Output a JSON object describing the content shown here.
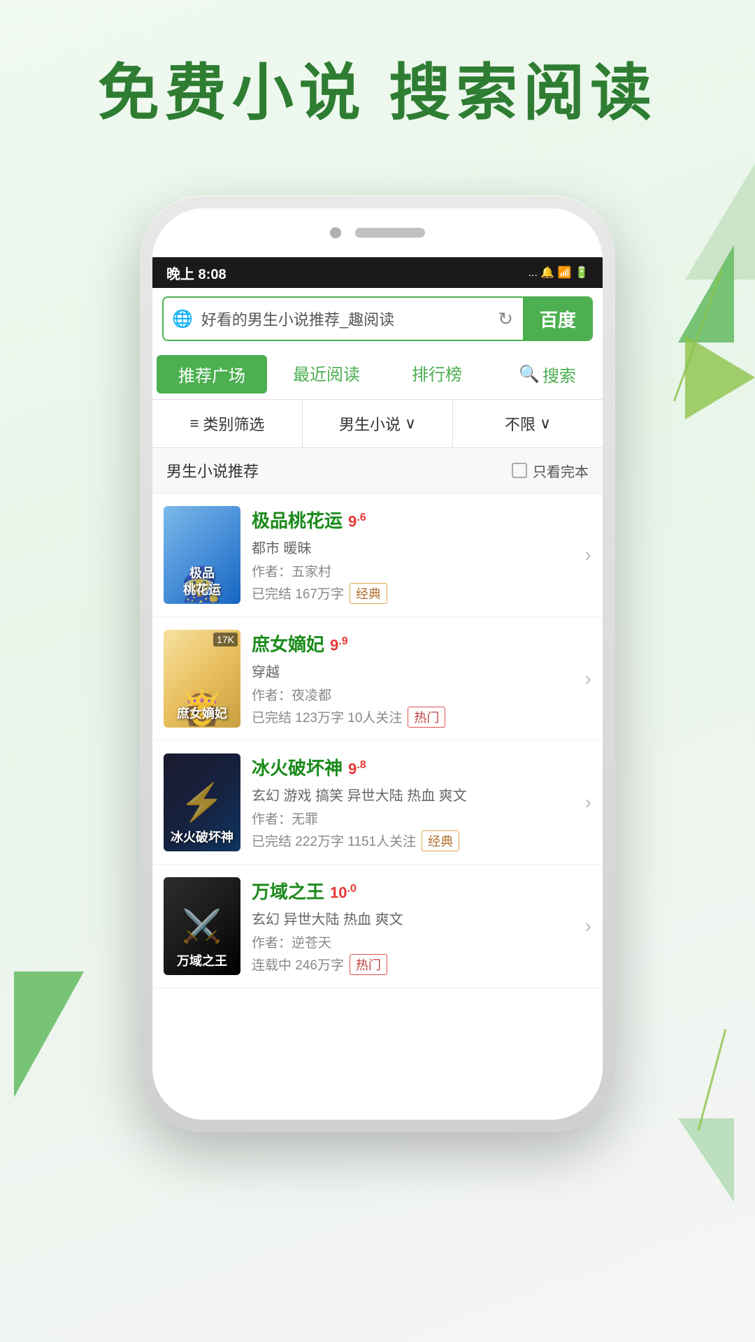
{
  "headline": {
    "line1": "免费小说  搜索阅读"
  },
  "status_bar": {
    "time": "晚上 8:08",
    "icons": "... 🔔 📶 🔋"
  },
  "search": {
    "placeholder": "好看的男生小说推荐_趣阅读",
    "button_label": "百度",
    "globe_icon": "🌐"
  },
  "nav": {
    "tabs": [
      {
        "id": "recommend",
        "label": "推荐广场",
        "active": true
      },
      {
        "id": "recent",
        "label": "最近阅读",
        "active": false
      },
      {
        "id": "ranking",
        "label": "排行榜",
        "active": false
      },
      {
        "id": "search",
        "label": "搜索",
        "active": false,
        "icon": "🔍"
      }
    ]
  },
  "filter": {
    "items": [
      {
        "id": "category",
        "label": "类别筛选",
        "icon": "≡"
      },
      {
        "id": "gender",
        "label": "男生小说",
        "arrow": "∨"
      },
      {
        "id": "limit",
        "label": "不限",
        "arrow": "∨"
      }
    ]
  },
  "section": {
    "title": "男生小说推荐",
    "checkbox_label": "只看完本"
  },
  "books": [
    {
      "id": 1,
      "title": "极品桃花运",
      "rating": "9",
      "rating_decimal": "6",
      "tags": "都市 暖昧",
      "author": "作者：五家村",
      "meta": "已完结 167万字",
      "badge": "经典",
      "badge_type": "classic",
      "cover_text": "极品\n桃花运",
      "cover_class": "cover-1"
    },
    {
      "id": 2,
      "title": "庶女嫡妃",
      "rating": "9",
      "rating_decimal": "9",
      "tags": "穿越",
      "author": "作者：夜凌都",
      "meta": "已完结 123万字 10人关注",
      "badge": "热门",
      "badge_type": "hot",
      "cover_text": "庶女嫡妃",
      "cover_class": "cover-2",
      "cover_badge": "17K"
    },
    {
      "id": 3,
      "title": "冰火破坏神",
      "rating": "9",
      "rating_decimal": "8",
      "tags": "玄幻 游戏 搞笑 异世大陆 热血 爽文",
      "author": "作者：无罪",
      "meta": "已完结 222万字 1151人关注",
      "badge": "经典",
      "badge_type": "classic",
      "cover_text": "冰火破坏神",
      "cover_class": "cover-3"
    },
    {
      "id": 4,
      "title": "万域之王",
      "rating": "10",
      "rating_decimal": "0",
      "tags": "玄幻 异世大陆 热血 爽文",
      "author": "作者：逆苍天",
      "meta": "连载中 246万字",
      "badge": "热门",
      "badge_type": "hot",
      "cover_text": "万域之王",
      "cover_class": "cover-4"
    }
  ]
}
